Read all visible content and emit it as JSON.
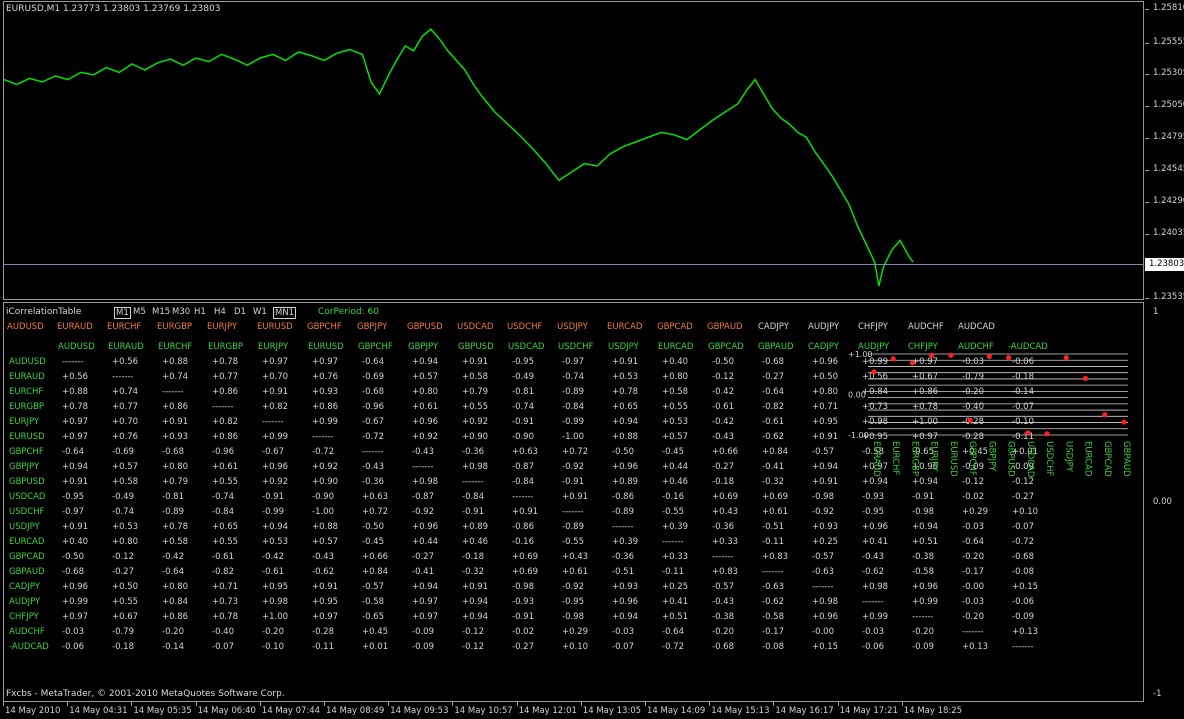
{
  "header": {
    "symbol_info": "EURUSD,M1  1.23773 1.23803 1.23769 1.23803"
  },
  "price_axis": {
    "labels": [
      "1.25810",
      "1.25555",
      "1.25305",
      "1.25050",
      "1.24795",
      "1.24545",
      "1.24290",
      "1.24035",
      "1.23803",
      "1.23535"
    ],
    "current_price": "1.23803"
  },
  "sub_axis": {
    "top": "1",
    "mid": "0.00",
    "bottom": "-1"
  },
  "time_axis": [
    "14 May 2010",
    "14 May 04:31",
    "14 May 05:35",
    "14 May 06:40",
    "14 May 07:44",
    "14 May 08:49",
    "14 May 09:53",
    "14 May 10:57",
    "14 May 12:01",
    "14 May 13:05",
    "14 May 14:09",
    "14 May 15:13",
    "14 May 16:17",
    "14 May 17:21",
    "14 May 18:25"
  ],
  "indicator": {
    "name": "iCorrelationTable",
    "timeframes": [
      "M1",
      "M5",
      "M15",
      "M30",
      "H1",
      "H4",
      "D1",
      "W1",
      "MN1"
    ],
    "selected_timeframes": [
      "M1",
      "MN1"
    ],
    "corperiod_label": "CorPeriod:",
    "corperiod_value": "60"
  },
  "orange_header": [
    "AUDUSD",
    "EURAUD",
    "EURCHF",
    "EURGBP",
    "EURJPY",
    "EURUSD",
    "GBPCHF",
    "GBPJPY",
    "GBPUSD",
    "USDCAD",
    "USDCHF",
    "USDJPY",
    "EURCAD",
    "GBPCAD",
    "GBPAUD"
  ],
  "white_header": [
    "CADJPY",
    "AUDJPY",
    "CHFJPY",
    "AUDCHF",
    "AUDCAD"
  ],
  "col_header": [
    "AUDUSD",
    "EURAUD",
    "EURCHF",
    "EURGBP",
    "EURJPY",
    "EURUSD",
    "GBPCHF",
    "GBPJPY",
    "GBPUSD",
    "USDCAD",
    "USDCHF",
    "USDJPY",
    "EURCAD",
    "GBPCAD",
    "GBPAUD",
    "CADJPY",
    "AUDJPY",
    "CHFJPY",
    "AUDCHF",
    "-AUDCAD"
  ],
  "row_header": [
    "AUDUSD",
    "EURAUD",
    "EURCHF",
    "EURGBP",
    "EURJPY",
    "EURUSD",
    "GBPCHF",
    "GBPJPY",
    "GBPUSD",
    "USDCAD",
    "USDCHF",
    "USDJPY",
    "EURCAD",
    "GBPCAD",
    "GBPAUD",
    "CADJPY",
    "AUDJPY",
    "CHFJPY",
    "AUDCHF",
    "-AUDCAD"
  ],
  "matrix": [
    [
      "-------",
      "+0.56",
      "+0.88",
      "+0.78",
      "+0.97",
      "+0.97",
      "-0.64",
      "+0.94",
      "+0.91",
      "-0.95",
      "-0.97",
      "+0.91",
      "+0.40",
      "-0.50",
      "-0.68",
      "+0.96",
      "+0.99",
      "+0.97",
      "-0.03",
      "-0.06"
    ],
    [
      "+0.56",
      "-------",
      "+0.74",
      "+0.77",
      "+0.70",
      "+0.76",
      "-0.69",
      "+0.57",
      "+0.58",
      "-0.49",
      "-0.74",
      "+0.53",
      "+0.80",
      "-0.12",
      "-0.27",
      "+0.50",
      "+0.56",
      "+0.67",
      "-0.79",
      "-0.18"
    ],
    [
      "+0.88",
      "+0.74",
      "-------",
      "+0.86",
      "+0.91",
      "+0.93",
      "-0.68",
      "+0.80",
      "+0.79",
      "-0.81",
      "-0.89",
      "+0.78",
      "+0.58",
      "-0.42",
      "-0.64",
      "+0.80",
      "+0.84",
      "+0.86",
      "-0.20",
      "-0.14"
    ],
    [
      "+0.78",
      "+0.77",
      "+0.86",
      "-------",
      "+0.82",
      "+0.86",
      "-0.96",
      "+0.61",
      "+0.55",
      "-0.74",
      "-0.84",
      "+0.65",
      "+0.55",
      "-0.61",
      "-0.82",
      "+0.71",
      "+0.73",
      "+0.78",
      "-0.40",
      "-0.07"
    ],
    [
      "+0.97",
      "+0.70",
      "+0.91",
      "+0.82",
      "-------",
      "+0.99",
      "-0.67",
      "+0.96",
      "+0.92",
      "-0.91",
      "-0.99",
      "+0.94",
      "+0.53",
      "-0.42",
      "-0.61",
      "+0.95",
      "+0.98",
      "+1.00",
      "-0.28",
      "-0.10"
    ],
    [
      "+0.97",
      "+0.76",
      "+0.93",
      "+0.86",
      "+0.99",
      "-------",
      "-0.72",
      "+0.92",
      "+0.90",
      "-0.90",
      "-1.00",
      "+0.88",
      "+0.57",
      "-0.43",
      "-0.62",
      "+0.91",
      "+0.95",
      "+0.97",
      "-0.28",
      "-0.11"
    ],
    [
      "-0.64",
      "-0.69",
      "-0.68",
      "-0.96",
      "-0.67",
      "-0.72",
      "-------",
      "-0.43",
      "-0.36",
      "+0.63",
      "+0.72",
      "-0.50",
      "-0.45",
      "+0.66",
      "+0.84",
      "-0.57",
      "-0.58",
      "-0.65",
      "+0.45",
      "+0.01"
    ],
    [
      "+0.94",
      "+0.57",
      "+0.80",
      "+0.61",
      "+0.96",
      "+0.92",
      "-0.43",
      "-------",
      "+0.98",
      "-0.87",
      "-0.92",
      "+0.96",
      "+0.44",
      "-0.27",
      "-0.41",
      "+0.94",
      "+0.97",
      "+0.96",
      "-0.09",
      "-0.09"
    ],
    [
      "+0.91",
      "+0.58",
      "+0.79",
      "+0.55",
      "+0.92",
      "+0.90",
      "-0.36",
      "+0.98",
      "-------",
      "-0.84",
      "-0.91",
      "+0.89",
      "+0.46",
      "-0.18",
      "-0.32",
      "+0.91",
      "+0.94",
      "+0.94",
      "-0.12",
      "-0.12"
    ],
    [
      "-0.95",
      "-0.49",
      "-0.81",
      "-0.74",
      "-0.91",
      "-0.90",
      "+0.63",
      "-0.87",
      "-0.84",
      "-------",
      "+0.91",
      "-0.86",
      "-0.16",
      "+0.69",
      "+0.69",
      "-0.98",
      "-0.93",
      "-0.91",
      "-0.02",
      "-0.27"
    ],
    [
      "-0.97",
      "-0.74",
      "-0.89",
      "-0.84",
      "-0.99",
      "-1.00",
      "+0.72",
      "-0.92",
      "-0.91",
      "+0.91",
      "-------",
      "-0.89",
      "-0.55",
      "+0.43",
      "+0.61",
      "-0.92",
      "-0.95",
      "-0.98",
      "+0.29",
      "+0.10"
    ],
    [
      "+0.91",
      "+0.53",
      "+0.78",
      "+0.65",
      "+0.94",
      "+0.88",
      "-0.50",
      "+0.96",
      "+0.89",
      "-0.86",
      "-0.89",
      "-------",
      "+0.39",
      "-0.36",
      "-0.51",
      "+0.93",
      "+0.96",
      "+0.94",
      "-0.03",
      "-0.07"
    ],
    [
      "+0.40",
      "+0.80",
      "+0.58",
      "+0.55",
      "+0.53",
      "+0.57",
      "-0.45",
      "+0.44",
      "+0.46",
      "-0.16",
      "-0.55",
      "+0.39",
      "-------",
      "+0.33",
      "-0.11",
      "+0.25",
      "+0.41",
      "+0.51",
      "-0.64",
      "-0.72"
    ],
    [
      "-0.50",
      "-0.12",
      "-0.42",
      "-0.61",
      "-0.42",
      "-0.43",
      "+0.66",
      "-0.27",
      "-0.18",
      "+0.69",
      "+0.43",
      "-0.36",
      "+0.33",
      "-------",
      "+0.83",
      "-0.57",
      "-0.43",
      "-0.38",
      "-0.20",
      "-0.68"
    ],
    [
      "-0.68",
      "-0.27",
      "-0.64",
      "-0.82",
      "-0.61",
      "-0.62",
      "+0.84",
      "-0.41",
      "-0.32",
      "+0.69",
      "+0.61",
      "-0.51",
      "-0.11",
      "+0.83",
      "-------",
      "-0.63",
      "-0.62",
      "-0.58",
      "-0.17",
      "-0.08"
    ],
    [
      "+0.96",
      "+0.50",
      "+0.80",
      "+0.71",
      "+0.95",
      "+0.91",
      "-0.57",
      "+0.94",
      "+0.91",
      "-0.98",
      "-0.92",
      "+0.93",
      "+0.25",
      "-0.57",
      "-0.63",
      "-------",
      "+0.98",
      "+0.96",
      "-0.00",
      "+0.15"
    ],
    [
      "+0.99",
      "+0.55",
      "+0.84",
      "+0.73",
      "+0.98",
      "+0.95",
      "-0.58",
      "+0.97",
      "+0.94",
      "-0.93",
      "-0.95",
      "+0.96",
      "+0.41",
      "-0.43",
      "-0.62",
      "+0.98",
      "-------",
      "+0.99",
      "-0.03",
      "-0.06"
    ],
    [
      "+0.97",
      "+0.67",
      "+0.86",
      "+0.78",
      "+1.00",
      "+0.97",
      "-0.65",
      "+0.97",
      "+0.94",
      "-0.91",
      "-0.98",
      "+0.94",
      "+0.51",
      "-0.38",
      "-0.58",
      "+0.96",
      "+0.99",
      "-------",
      "-0.20",
      "-0.09"
    ],
    [
      "-0.03",
      "-0.79",
      "-0.20",
      "-0.40",
      "-0.20",
      "-0.28",
      "+0.45",
      "-0.09",
      "-0.12",
      "-0.02",
      "+0.29",
      "-0.03",
      "-0.64",
      "-0.20",
      "-0.17",
      "-0.00",
      "-0.03",
      "-0.20",
      "-------",
      "+0.13"
    ],
    [
      "-0.06",
      "-0.18",
      "-0.14",
      "-0.07",
      "-0.10",
      "-0.11",
      "+0.01",
      "-0.09",
      "-0.12",
      "-0.27",
      "+0.10",
      "-0.07",
      "-0.72",
      "-0.68",
      "-0.08",
      "+0.15",
      "-0.06",
      "-0.09",
      "+0.13",
      "-------"
    ]
  ],
  "mini_chart": {
    "axis_labels": [
      "+1.00",
      "0.00",
      "-1.00"
    ],
    "symbols": [
      "EURAUD",
      "EURCHF",
      "EURGBP",
      "EURJPY",
      "EURUSD",
      "GBPCHF",
      "GBPJPY",
      "GBPUSD",
      "USDCAD",
      "USDCHF",
      "USDJPY",
      "EURCAD",
      "GBPCAD",
      "GBPAUD"
    ],
    "values": [
      0.56,
      0.88,
      0.78,
      0.97,
      0.97,
      -0.64,
      0.94,
      0.91,
      -0.95,
      -0.97,
      0.91,
      0.4,
      -0.5,
      -0.68
    ]
  },
  "price_series": {
    "points": [
      [
        0,
        1.2532
      ],
      [
        3,
        1.2528
      ],
      [
        6,
        1.2533
      ],
      [
        9,
        1.253
      ],
      [
        12,
        1.2535
      ],
      [
        15,
        1.2532
      ],
      [
        18,
        1.2538
      ],
      [
        21,
        1.2536
      ],
      [
        24,
        1.2542
      ],
      [
        27,
        1.2538
      ],
      [
        30,
        1.2545
      ],
      [
        33,
        1.254
      ],
      [
        36,
        1.2546
      ],
      [
        39,
        1.2549
      ],
      [
        42,
        1.2544
      ],
      [
        45,
        1.255
      ],
      [
        48,
        1.2547
      ],
      [
        51,
        1.2553
      ],
      [
        54,
        1.2549
      ],
      [
        57,
        1.2544
      ],
      [
        60,
        1.255
      ],
      [
        63,
        1.2553
      ],
      [
        66,
        1.2548
      ],
      [
        69,
        1.2555
      ],
      [
        72,
        1.2552
      ],
      [
        75,
        1.2548
      ],
      [
        78,
        1.2554
      ],
      [
        81,
        1.2557
      ],
      [
        84,
        1.2553
      ],
      [
        86,
        1.253
      ],
      [
        88,
        1.252
      ],
      [
        90,
        1.2535
      ],
      [
        92,
        1.2548
      ],
      [
        94,
        1.256
      ],
      [
        96,
        1.2556
      ],
      [
        98,
        1.2568
      ],
      [
        100,
        1.2574
      ],
      [
        102,
        1.2566
      ],
      [
        104,
        1.2556
      ],
      [
        106,
        1.2548
      ],
      [
        108,
        1.254
      ],
      [
        110,
        1.2528
      ],
      [
        112,
        1.2518
      ],
      [
        115,
        1.2505
      ],
      [
        118,
        1.2495
      ],
      [
        121,
        1.2485
      ],
      [
        124,
        1.2474
      ],
      [
        127,
        1.2462
      ],
      [
        130,
        1.2448
      ],
      [
        133,
        1.2455
      ],
      [
        136,
        1.2462
      ],
      [
        139,
        1.246
      ],
      [
        142,
        1.247
      ],
      [
        145,
        1.2476
      ],
      [
        148,
        1.248
      ],
      [
        151,
        1.2484
      ],
      [
        154,
        1.2488
      ],
      [
        157,
        1.2486
      ],
      [
        160,
        1.2482
      ],
      [
        163,
        1.249
      ],
      [
        166,
        1.2498
      ],
      [
        169,
        1.2505
      ],
      [
        172,
        1.2512
      ],
      [
        174,
        1.2523
      ],
      [
        176,
        1.2532
      ],
      [
        178,
        1.252
      ],
      [
        180,
        1.2508
      ],
      [
        182,
        1.25
      ],
      [
        184,
        1.2495
      ],
      [
        186,
        1.2488
      ],
      [
        188,
        1.2484
      ],
      [
        190,
        1.2472
      ],
      [
        192,
        1.2462
      ],
      [
        194,
        1.2452
      ],
      [
        196,
        1.244
      ],
      [
        198,
        1.2428
      ],
      [
        200,
        1.241
      ],
      [
        202,
        1.2395
      ],
      [
        204,
        1.238
      ],
      [
        205,
        1.236
      ],
      [
        206,
        1.2375
      ],
      [
        208,
        1.239
      ],
      [
        210,
        1.2398
      ],
      [
        212,
        1.2385
      ],
      [
        213,
        1.238
      ]
    ],
    "ymin": 1.235,
    "ymax": 1.259
  },
  "colors": {
    "price_line": "#00e400",
    "orange": "#f07a3a",
    "green": "#3bd43b",
    "dot": "#ff2020"
  },
  "footer": {
    "copyright": "Fxcbs - MetaTrader, © 2001-2010 MetaQuotes Software Corp."
  }
}
